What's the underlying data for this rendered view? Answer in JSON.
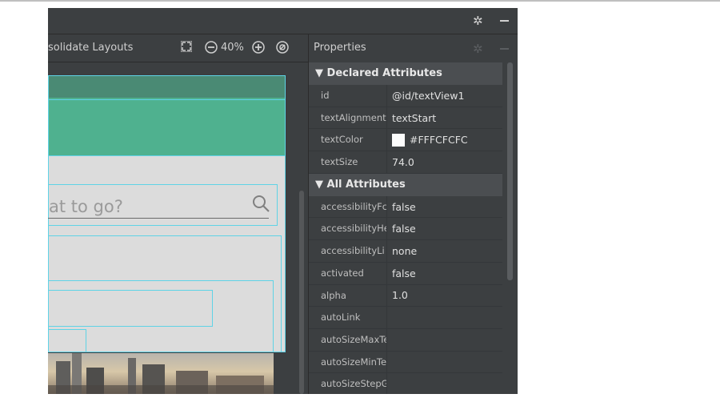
{
  "toolbar": {
    "label": "solidate Layouts",
    "zoom_out_icon": "zoom-out-icon",
    "zoom_level": "40%",
    "zoom_in_icon": "zoom-in-icon",
    "fit_icon": "fit-screen-icon",
    "refresh_icon": "refresh-icon"
  },
  "titlebar": {
    "gear_icon": "gear-icon",
    "minimize_icon": "minimize-icon"
  },
  "preview": {
    "search_hint": "at to go?",
    "search_icon": "search-icon",
    "colors": {
      "header": "#4a8a74",
      "toolbar": "#4fb18f",
      "body": "#dcdcdc",
      "outline": "#5fd3e6"
    }
  },
  "properties": {
    "title": "Properties",
    "declared_title": "Declared Attributes",
    "declared": [
      {
        "key": "id",
        "value": "@id/textView1"
      },
      {
        "key": "textAlignment",
        "value": "textStart"
      },
      {
        "key": "textColor",
        "value": "#FFFCFCFC",
        "swatch": "#FCFCFC"
      },
      {
        "key": "textSize",
        "value": "74.0"
      }
    ],
    "all_title": "All Attributes",
    "all": [
      {
        "key": "accessibilityFc",
        "value": "false"
      },
      {
        "key": "accessibilityHe",
        "value": "false"
      },
      {
        "key": "accessibilityLi",
        "value": "none"
      },
      {
        "key": "activated",
        "value": "false"
      },
      {
        "key": "alpha",
        "value": "1.0"
      },
      {
        "key": "autoLink",
        "value": ""
      },
      {
        "key": "autoSizeMaxTe",
        "value": ""
      },
      {
        "key": "autoSizeMinTe",
        "value": ""
      },
      {
        "key": "autoSizeStepG",
        "value": ""
      }
    ]
  }
}
